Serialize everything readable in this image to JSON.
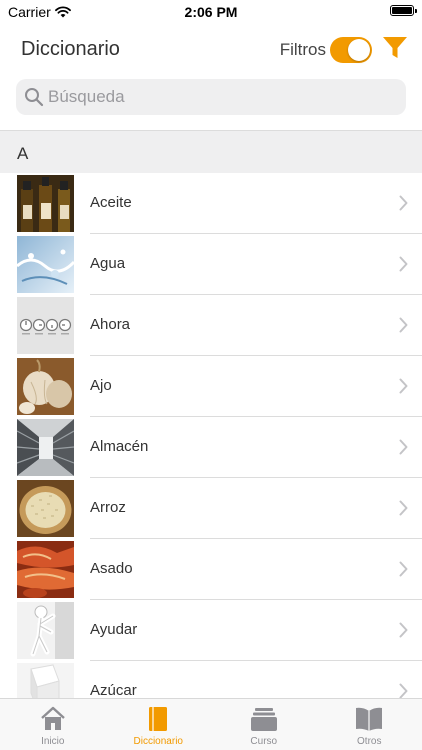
{
  "status_bar": {
    "carrier": "Carrier",
    "time": "2:06 PM"
  },
  "header": {
    "title": "Diccionario",
    "filters_label": "Filtros",
    "filters_on": true
  },
  "search": {
    "placeholder": "Búsqueda",
    "value": ""
  },
  "section": {
    "letter": "A"
  },
  "items": [
    {
      "label": "Aceite",
      "thumb": "olive-oil-bottles"
    },
    {
      "label": "Agua",
      "thumb": "water-splash"
    },
    {
      "label": "Ahora",
      "thumb": "clocks"
    },
    {
      "label": "Ajo",
      "thumb": "garlic"
    },
    {
      "label": "Almacén",
      "thumb": "warehouse-shelves"
    },
    {
      "label": "Arroz",
      "thumb": "rice-bowl"
    },
    {
      "label": "Asado",
      "thumb": "roast-meat"
    },
    {
      "label": "Ayudar",
      "thumb": "helping-figure"
    },
    {
      "label": "Azúcar",
      "thumb": "sugar-cubes"
    }
  ],
  "tabs": [
    {
      "label": "Inicio",
      "icon": "home-icon",
      "active": false
    },
    {
      "label": "Diccionario",
      "icon": "book-icon",
      "active": true
    },
    {
      "label": "Curso",
      "icon": "stack-icon",
      "active": false
    },
    {
      "label": "Otros",
      "icon": "open-book-icon",
      "active": false
    }
  ],
  "colors": {
    "accent": "#f29a00",
    "inactive": "#8e8e93"
  }
}
